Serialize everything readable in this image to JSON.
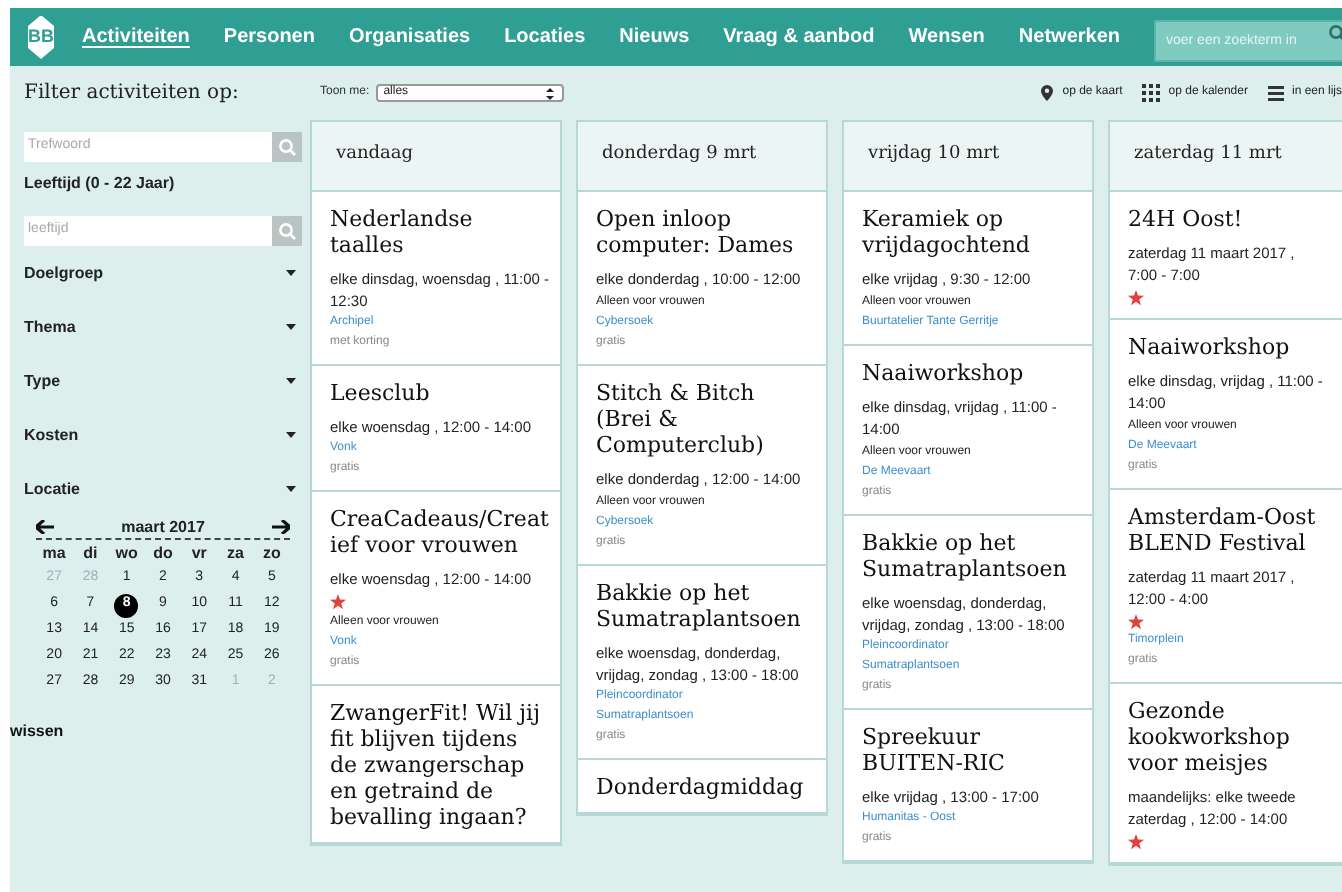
{
  "nav": {
    "logo": "BB",
    "items": [
      {
        "label": "Activiteiten",
        "selected": true
      },
      {
        "label": "Personen",
        "selected": false
      },
      {
        "label": "Organisaties",
        "selected": false
      },
      {
        "label": "Locaties",
        "selected": false
      },
      {
        "label": "Nieuws",
        "selected": false
      },
      {
        "label": "Vraag & aanbod",
        "selected": false
      },
      {
        "label": "Wensen",
        "selected": false
      },
      {
        "label": "Netwerken",
        "selected": false
      }
    ],
    "search": {
      "placeholder": "voer een zoekterm in"
    }
  },
  "toolbar": {
    "title": "Filter activiteiten op:",
    "show_label": "Toon me:",
    "show_value": "alles",
    "views": [
      {
        "kind": "map",
        "label": "op de kaart"
      },
      {
        "kind": "calendar",
        "label": "op de kalender"
      },
      {
        "kind": "list",
        "label": "in een lijs"
      }
    ]
  },
  "sidebar": {
    "keyword": {
      "placeholder": "Trefwoord"
    },
    "age_label": "Leeftijd (0 - 22 Jaar)",
    "age": {
      "placeholder": "leeftijd"
    },
    "filters": [
      "Doelgroep",
      "Thema",
      "Type",
      "Kosten",
      "Locatie"
    ],
    "calendar": {
      "month": "maart 2017",
      "weekdays": [
        "ma",
        "di",
        "wo",
        "do",
        "vr",
        "za",
        "zo"
      ],
      "weeks": [
        [
          {
            "day": "27",
            "other_month": true,
            "selected": false
          },
          {
            "day": "28",
            "other_month": true,
            "selected": false
          },
          {
            "day": "1",
            "other_month": false,
            "selected": false
          },
          {
            "day": "2",
            "other_month": false,
            "selected": false
          },
          {
            "day": "3",
            "other_month": false,
            "selected": false
          },
          {
            "day": "4",
            "other_month": false,
            "selected": false
          },
          {
            "day": "5",
            "other_month": false,
            "selected": false
          }
        ],
        [
          {
            "day": "6",
            "other_month": false,
            "selected": false
          },
          {
            "day": "7",
            "other_month": false,
            "selected": false
          },
          {
            "day": "8",
            "other_month": false,
            "selected": true
          },
          {
            "day": "9",
            "other_month": false,
            "selected": false
          },
          {
            "day": "10",
            "other_month": false,
            "selected": false
          },
          {
            "day": "11",
            "other_month": false,
            "selected": false
          },
          {
            "day": "12",
            "other_month": false,
            "selected": false
          }
        ],
        [
          {
            "day": "13",
            "other_month": false,
            "selected": false
          },
          {
            "day": "14",
            "other_month": false,
            "selected": false
          },
          {
            "day": "15",
            "other_month": false,
            "selected": false
          },
          {
            "day": "16",
            "other_month": false,
            "selected": false
          },
          {
            "day": "17",
            "other_month": false,
            "selected": false
          },
          {
            "day": "18",
            "other_month": false,
            "selected": false
          },
          {
            "day": "19",
            "other_month": false,
            "selected": false
          }
        ],
        [
          {
            "day": "20",
            "other_month": false,
            "selected": false
          },
          {
            "day": "21",
            "other_month": false,
            "selected": false
          },
          {
            "day": "22",
            "other_month": false,
            "selected": false
          },
          {
            "day": "23",
            "other_month": false,
            "selected": false
          },
          {
            "day": "24",
            "other_month": false,
            "selected": false
          },
          {
            "day": "25",
            "other_month": false,
            "selected": false
          },
          {
            "day": "26",
            "other_month": false,
            "selected": false
          }
        ],
        [
          {
            "day": "27",
            "other_month": false,
            "selected": false
          },
          {
            "day": "28",
            "other_month": false,
            "selected": false
          },
          {
            "day": "29",
            "other_month": false,
            "selected": false
          },
          {
            "day": "30",
            "other_month": false,
            "selected": false
          },
          {
            "day": "31",
            "other_month": false,
            "selected": false
          },
          {
            "day": "1",
            "other_month": true,
            "selected": false
          },
          {
            "day": "2",
            "other_month": true,
            "selected": false
          }
        ]
      ]
    },
    "clear": "wissen"
  },
  "columns": [
    {
      "heading": "vandaag",
      "events": [
        {
          "title": "Nederlandse taalles",
          "schedule": "elke dinsdag, woensdag , 11:00 - 12:30",
          "starred": false,
          "links": [
            "Archipel"
          ],
          "price": "met korting"
        },
        {
          "title": "Leesclub",
          "schedule": "elke woensdag , 12:00 - 14:00",
          "starred": false,
          "links": [
            "Vonk"
          ],
          "price": "gratis"
        },
        {
          "title": "CreaCadeaus/Creatief voor vrouwen",
          "schedule": "elke woensdag , 12:00 - 14:00",
          "starred": true,
          "note": "Alleen voor vrouwen",
          "links": [
            "Vonk"
          ],
          "price": "gratis"
        },
        {
          "title": "ZwangerFit! Wil jij fit blijven tijdens de zwangerschap en getraind de bevalling ingaan?",
          "starred": false
        }
      ]
    },
    {
      "heading": "donderdag 9 mrt",
      "events": [
        {
          "title": "Open inloop computer: Dames",
          "schedule": "elke donderdag , 10:00 - 12:00",
          "starred": false,
          "note": "Alleen voor vrouwen",
          "links": [
            "Cybersoek"
          ],
          "price": "gratis"
        },
        {
          "title": "Stitch & Bitch (Brei & Computerclub)",
          "schedule": "elke donderdag , 12:00 - 14:00",
          "starred": false,
          "note": "Alleen voor vrouwen",
          "links": [
            "Cybersoek"
          ],
          "price": "gratis"
        },
        {
          "title": "Bakkie op het Sumatraplantsoen",
          "schedule": "elke woensdag, donderdag, vrijdag, zondag , 13:00 - 18:00",
          "starred": false,
          "links": [
            "Pleincoordinator",
            "Sumatraplantsoen"
          ],
          "price": "gratis"
        },
        {
          "title": "Donderdagmiddag",
          "starred": false
        }
      ]
    },
    {
      "heading": "vrijdag 10 mrt",
      "events": [
        {
          "title": "Keramiek op vrijdagochtend",
          "schedule": "elke vrijdag , 9:30 - 12:00",
          "starred": false,
          "note": "Alleen voor vrouwen",
          "links": [
            "Buurtatelier Tante Gerritje"
          ]
        },
        {
          "title": "Naaiworkshop",
          "schedule": "elke dinsdag, vrijdag , 11:00 - 14:00",
          "starred": false,
          "note": "Alleen voor vrouwen",
          "links": [
            "De Meevaart"
          ],
          "price": "gratis"
        },
        {
          "title": "Bakkie op het Sumatraplantsoen",
          "schedule": "elke woensdag, donderdag, vrijdag, zondag , 13:00 - 18:00",
          "starred": false,
          "links": [
            "Pleincoordinator",
            "Sumatraplantsoen"
          ],
          "price": "gratis"
        },
        {
          "title": "Spreekuur BUITEN-RIC",
          "schedule": "elke vrijdag , 13:00 - 17:00",
          "starred": false,
          "links": [
            "Humanitas - Oost"
          ],
          "price": "gratis"
        }
      ]
    },
    {
      "heading": "zaterdag 11 mrt",
      "events": [
        {
          "title": "24H Oost!",
          "schedule": "zaterdag 11 maart 2017 , 7:00 - 7:00",
          "starred": true
        },
        {
          "title": "Naaiworkshop",
          "schedule": "elke dinsdag, vrijdag , 11:00 - 14:00",
          "starred": false,
          "note": "Alleen voor vrouwen",
          "links": [
            "De Meevaart"
          ],
          "price": "gratis"
        },
        {
          "title": "Amsterdam-Oost BLEND Festival",
          "schedule": "zaterdag 11 maart 2017 , 12:00 - 4:00",
          "starred": true,
          "links": [
            "Timorplein"
          ],
          "price": "gratis"
        },
        {
          "title": "Gezonde kookworkshop voor meisjes",
          "schedule": "maandelijks: elke tweede zaterdag , 12:00 - 14:00",
          "starred": true
        }
      ]
    }
  ]
}
